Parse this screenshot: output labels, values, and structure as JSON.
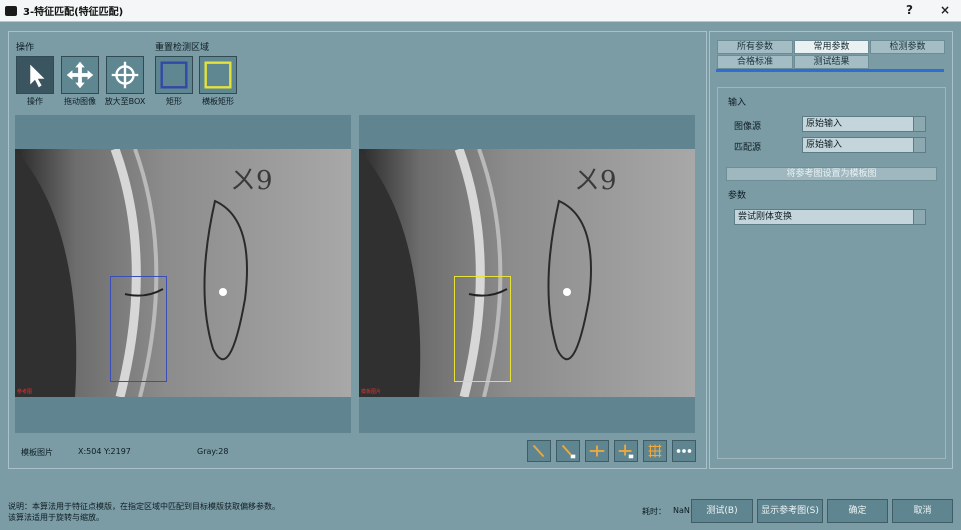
{
  "window": {
    "title": "3-特征匹配(特征匹配)",
    "help": "?",
    "close": "×"
  },
  "toolbar": {
    "operation_header": "操作",
    "region_header": "重置检测区域",
    "tools": [
      {
        "label": "操作",
        "icon": "pointer-icon"
      },
      {
        "label": "拖动图像",
        "icon": "move-icon"
      },
      {
        "label": "放大至BOX",
        "icon": "crosshair-icon"
      },
      {
        "label": "矩形",
        "icon": "rectangle-icon"
      },
      {
        "label": "横板矩形",
        "icon": "template-rectangle-icon"
      }
    ]
  },
  "views": {
    "left_tag": "参考图",
    "right_tag": "模板图片"
  },
  "status_bar": {
    "image_name": "模板图片",
    "coords": "X:504 Y:2197",
    "gray": "Gray:28"
  },
  "view_buttons": [
    "line-tool-icon",
    "line-add-icon",
    "cross-tool-icon",
    "cross-add-icon",
    "grid-icon",
    "more-icon"
  ],
  "tabs": {
    "row1": [
      "所有参数",
      "常用参数",
      "检测参数"
    ],
    "row2": [
      "合格标准",
      "测试结果"
    ],
    "active": "常用参数"
  },
  "settings": {
    "input_header": "输入",
    "image_source_label": "图像源",
    "image_source_value": "原始输入",
    "match_source_label": "匹配源",
    "match_source_value": "原始输入",
    "set_reference_button": "将参考图设置为模板图",
    "params_header": "参数",
    "transform_value": "尝试刚体变换"
  },
  "footer": {
    "note_line1": "说明：本算法用于特征点模版，在指定区域中匹配到目标模版获取偏移参数。",
    "note_line2": "该算法适用于旋转与缩放。",
    "time_label": "耗时：",
    "time_value": "NaN",
    "test_button": "测试(B)",
    "show_reference_button": "显示参考图(S)",
    "ok_button": "确定",
    "cancel_button": "取消"
  },
  "colors": {
    "roi_left": "#3b4db8",
    "roi_right": "#e6e23a",
    "accent": "#2d6ed3"
  }
}
